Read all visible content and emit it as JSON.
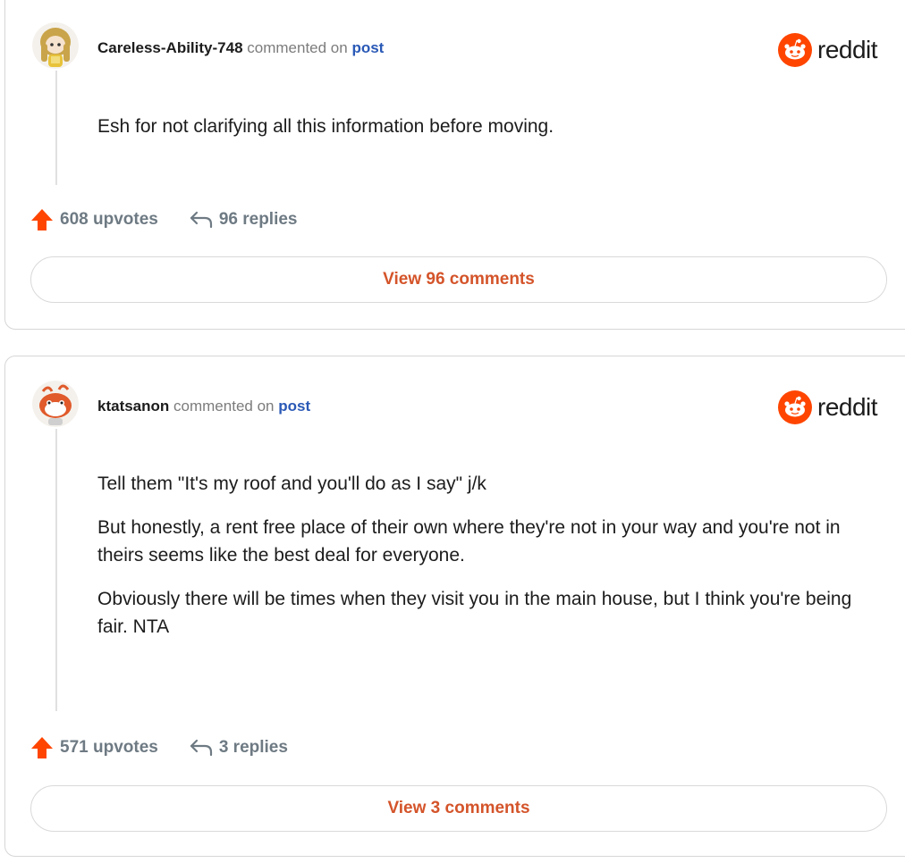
{
  "colors": {
    "reddit_orange": "#ff4500",
    "upvote_orange": "#ff4500",
    "link_blue": "#2a59b6",
    "button_text": "#d4542a",
    "meta_gray": "#7c7c7c"
  },
  "comments": [
    {
      "username": "Careless-Ability-748",
      "commented_on": "commented on",
      "post_link": "post",
      "logo_text": "reddit",
      "body": [
        "Esh for not clarifying all this information before moving."
      ],
      "upvotes": "608 upvotes",
      "replies": "96 replies",
      "view_button": "View 96 comments",
      "avatar_icon": "snoo-avatar-blonde-icon"
    },
    {
      "username": "ktatsanon",
      "commented_on": "commented on",
      "post_link": "post",
      "logo_text": "reddit",
      "body": [
        "Tell them \"It's my roof and you'll do as I say\" j/k",
        "But honestly, a rent free place of their own where they're not in your way and you're not in theirs seems like the best deal for everyone.",
        "Obviously there will be times when they visit you in the main house, but I think you're being fair. NTA"
      ],
      "upvotes": "571 upvotes",
      "replies": "3 replies",
      "view_button": "View 3 comments",
      "avatar_icon": "snoo-avatar-red-icon"
    }
  ]
}
